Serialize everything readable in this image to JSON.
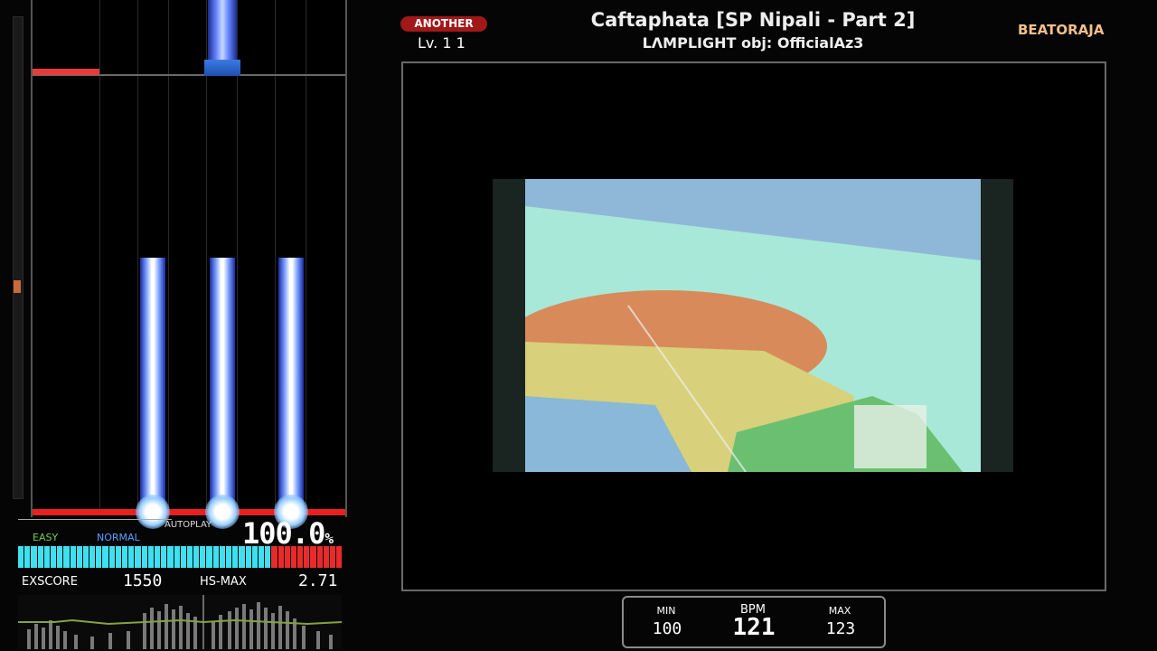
{
  "song": {
    "title": "Caftaphata [SP Nipali - Part 2]",
    "artist": "LΛMPLIGHT obj: OfficialAz3",
    "difficulty": "ANOTHER",
    "level": "Lv. 1 1"
  },
  "brand": "BEATORAJA",
  "play": {
    "autoplay_label": "AUTOPLAY",
    "percent": "100.0",
    "percent_unit": "%",
    "gauge_labels": {
      "easy": "EASY",
      "normal": "NORMAL"
    },
    "gauge_fill_fraction": 0.78,
    "exscore_label": "EXSCORE",
    "exscore_value": "1550",
    "hs_label": "HS-MAX",
    "hs_value": "2.71"
  },
  "bpm": {
    "label": "BPM",
    "min_label": "MIN",
    "max_label": "MAX",
    "min": "100",
    "current": "121",
    "max": "123"
  },
  "colors": {
    "gauge_cyan": "#3fe0f0",
    "gauge_red": "#e82a2a",
    "difficulty_badge": "#a01818",
    "brand": "#f3c08a"
  }
}
